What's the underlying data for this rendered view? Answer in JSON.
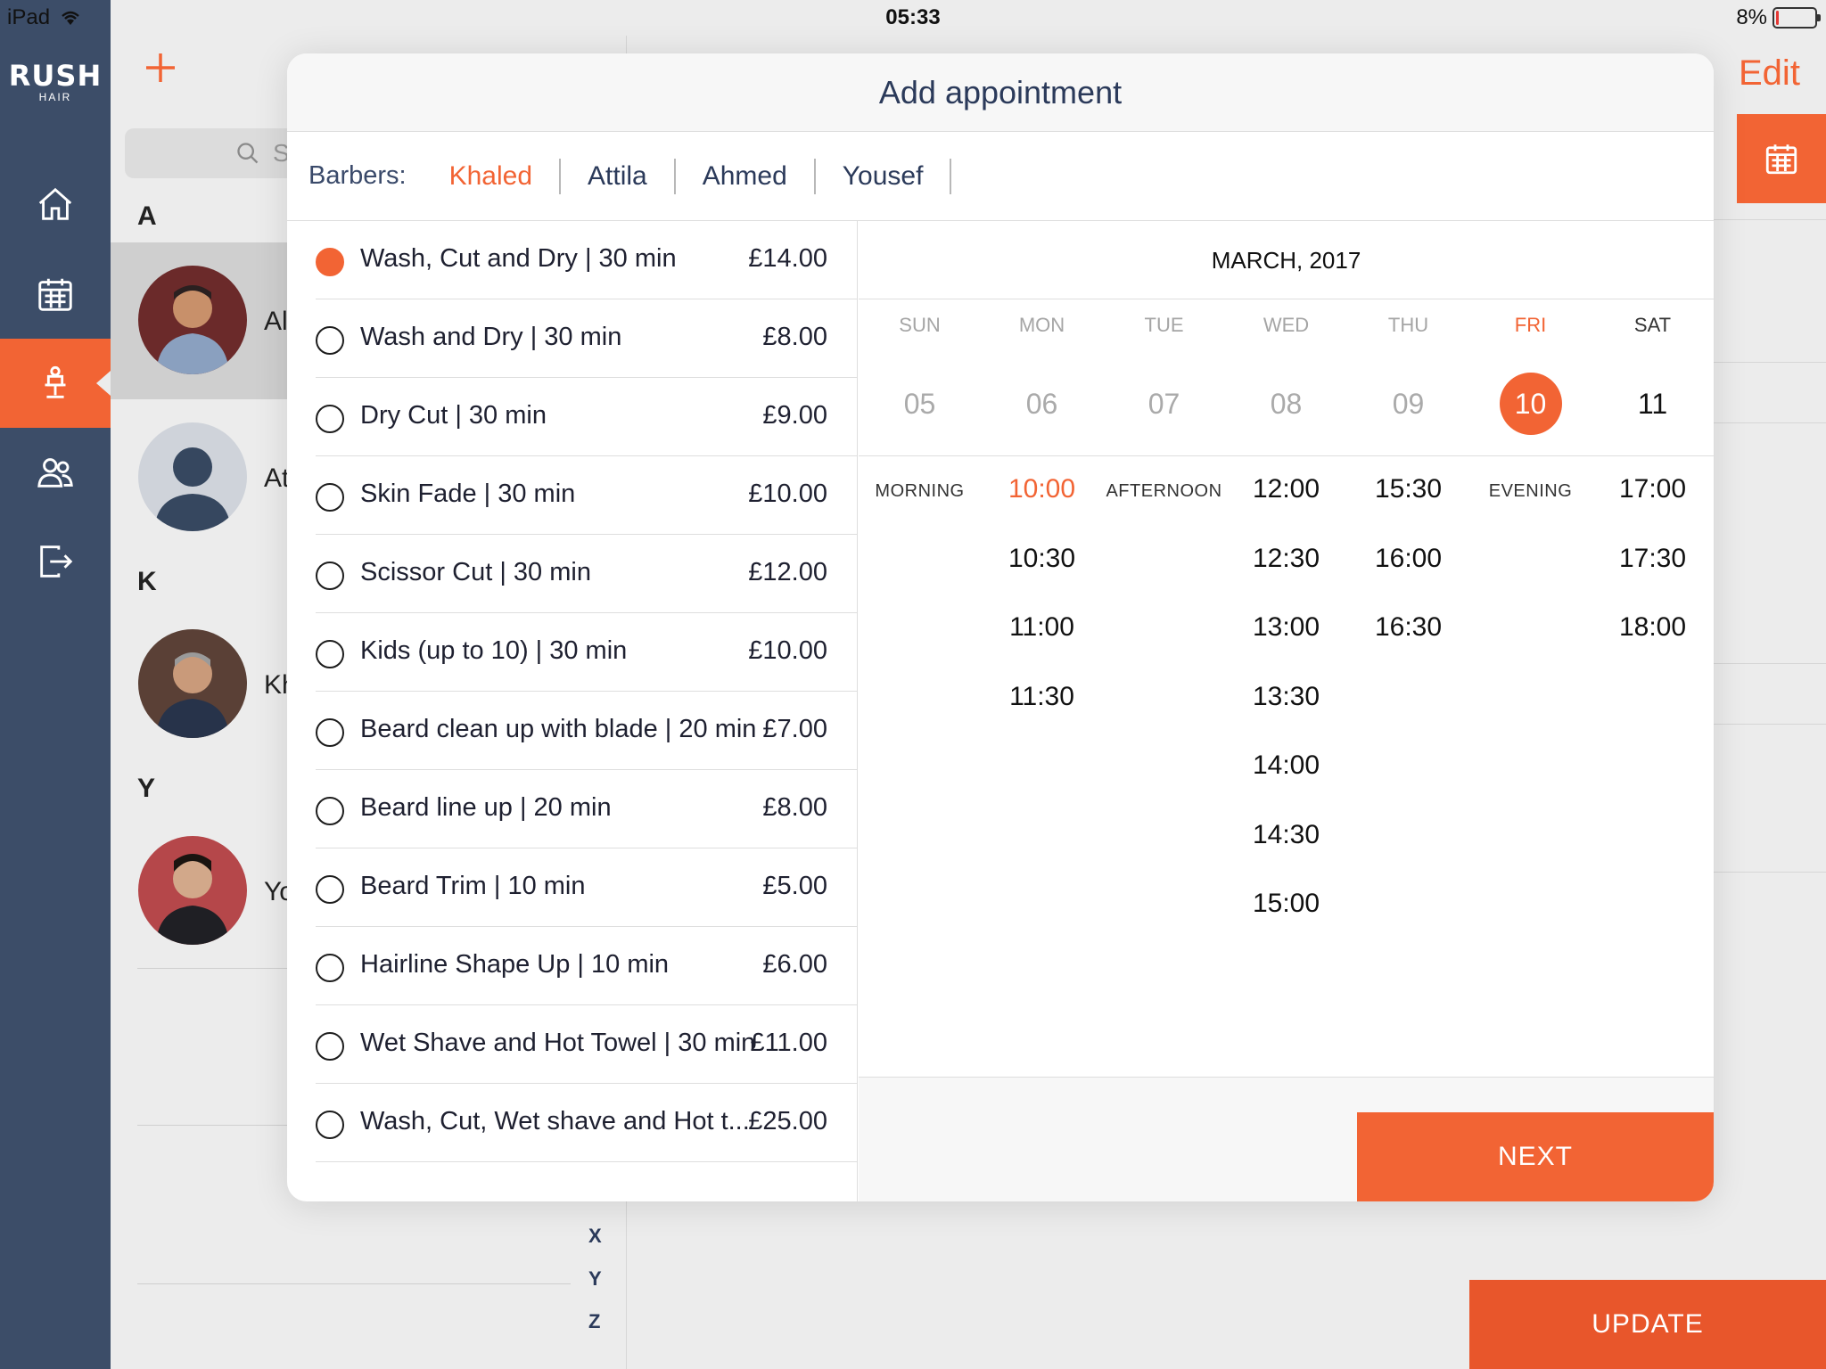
{
  "status": {
    "device": "iPad",
    "time": "05:33",
    "battery": "8%",
    "battery_level": 0.08
  },
  "brand": {
    "name": "RUSH",
    "sub": "HAIR"
  },
  "nav": [
    "home-icon",
    "calendar-icon",
    "barber-chair-icon",
    "users-icon",
    "logout-icon"
  ],
  "list": {
    "search_placeholder": "S",
    "sections": [
      {
        "letter": "A",
        "rows": [
          "Al",
          "At"
        ]
      },
      {
        "letter": "K",
        "rows": [
          "Kh"
        ]
      },
      {
        "letter": "Y",
        "rows": [
          "Yo"
        ]
      }
    ],
    "index": [
      "X",
      "Y",
      "Z"
    ]
  },
  "header": {
    "edit": "Edit",
    "update": "UPDATE"
  },
  "modal": {
    "title": "Add appointment",
    "barbers_label": "Barbers:",
    "barbers": [
      "Khaled",
      "Attila",
      "Ahmed",
      "Yousef"
    ],
    "selected_barber": "Khaled",
    "services": [
      {
        "name": "Wash, Cut and Dry | 30 min",
        "price": "£14.00",
        "selected": true
      },
      {
        "name": "Wash and Dry | 30 min",
        "price": "£8.00"
      },
      {
        "name": "Dry Cut | 30 min",
        "price": "£9.00"
      },
      {
        "name": "Skin Fade | 30 min",
        "price": "£10.00"
      },
      {
        "name": "Scissor Cut | 30 min",
        "price": "£12.00"
      },
      {
        "name": "Kids (up to 10) | 30 min",
        "price": "£10.00"
      },
      {
        "name": "Beard clean up with blade | 20 min",
        "price": "£7.00"
      },
      {
        "name": "Beard line up | 20 min",
        "price": "£8.00"
      },
      {
        "name": "Beard Trim | 10 min",
        "price": "£5.00"
      },
      {
        "name": "Hairline Shape Up | 10 min",
        "price": "£6.00"
      },
      {
        "name": "Wet Shave and Hot Towel | 30 min",
        "price": "£11.00"
      },
      {
        "name": "Wash, Cut, Wet shave and Hot t...",
        "price": "£25.00"
      }
    ],
    "calendar": {
      "month": "MARCH, 2017",
      "days": [
        {
          "dow": "SUN",
          "date": "05"
        },
        {
          "dow": "MON",
          "date": "06"
        },
        {
          "dow": "TUE",
          "date": "07"
        },
        {
          "dow": "WED",
          "date": "08"
        },
        {
          "dow": "THU",
          "date": "09"
        },
        {
          "dow": "FRI",
          "date": "10",
          "selected": true
        },
        {
          "dow": "SAT",
          "date": "11"
        }
      ],
      "periods": {
        "morning": "MORNING",
        "afternoon": "AFTERNOON",
        "evening": "EVENING"
      },
      "columns": [
        {
          "col": 1,
          "slots": [
            "10:00",
            "10:30",
            "11:00",
            "11:30"
          ]
        },
        {
          "col": 3,
          "slots": [
            "12:00",
            "12:30",
            "13:00",
            "13:30",
            "14:00",
            "14:30",
            "15:00"
          ]
        },
        {
          "col": 4,
          "slots": [
            "15:30",
            "16:00",
            "16:30"
          ]
        },
        {
          "col": 6,
          "slots": [
            "17:00",
            "17:30",
            "18:00"
          ]
        }
      ],
      "selected_slot": "10:00"
    },
    "next": "NEXT"
  },
  "colors": {
    "accent": "#f26434",
    "rail": "#3c4d68",
    "text": "#2b3a5a"
  }
}
